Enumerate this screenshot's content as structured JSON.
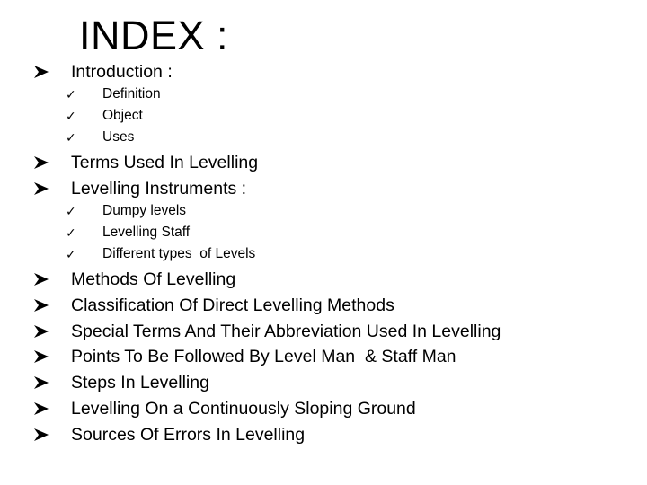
{
  "title": "INDEX :",
  "sections": [
    {
      "label": "Introduction :",
      "subitems": [
        "Definition",
        "Object",
        "Uses"
      ]
    },
    {
      "label": "Terms Used In Levelling",
      "subitems": []
    },
    {
      "label": "Levelling Instruments :",
      "subitems": [
        "Dumpy levels",
        "Levelling Staff",
        "Different types  of Levels"
      ]
    },
    {
      "label": "Methods Of Levelling",
      "subitems": []
    },
    {
      "label": "Classification Of Direct Levelling Methods",
      "subitems": []
    },
    {
      "label": "Special Terms And Their Abbreviation Used In Levelling",
      "subitems": []
    },
    {
      "label": "Points To Be Followed By Level Man  & Staff Man",
      "subitems": []
    },
    {
      "label": "Steps In Levelling",
      "subitems": []
    },
    {
      "label": "Levelling On a Continuously Sloping Ground",
      "subitems": []
    },
    {
      "label": "Sources Of Errors In Levelling",
      "subitems": []
    }
  ],
  "icons": {
    "bullet": "arrowhead-bullet-icon",
    "subbullet": "checkmark-icon",
    "checkmark_glyph": "✓"
  }
}
